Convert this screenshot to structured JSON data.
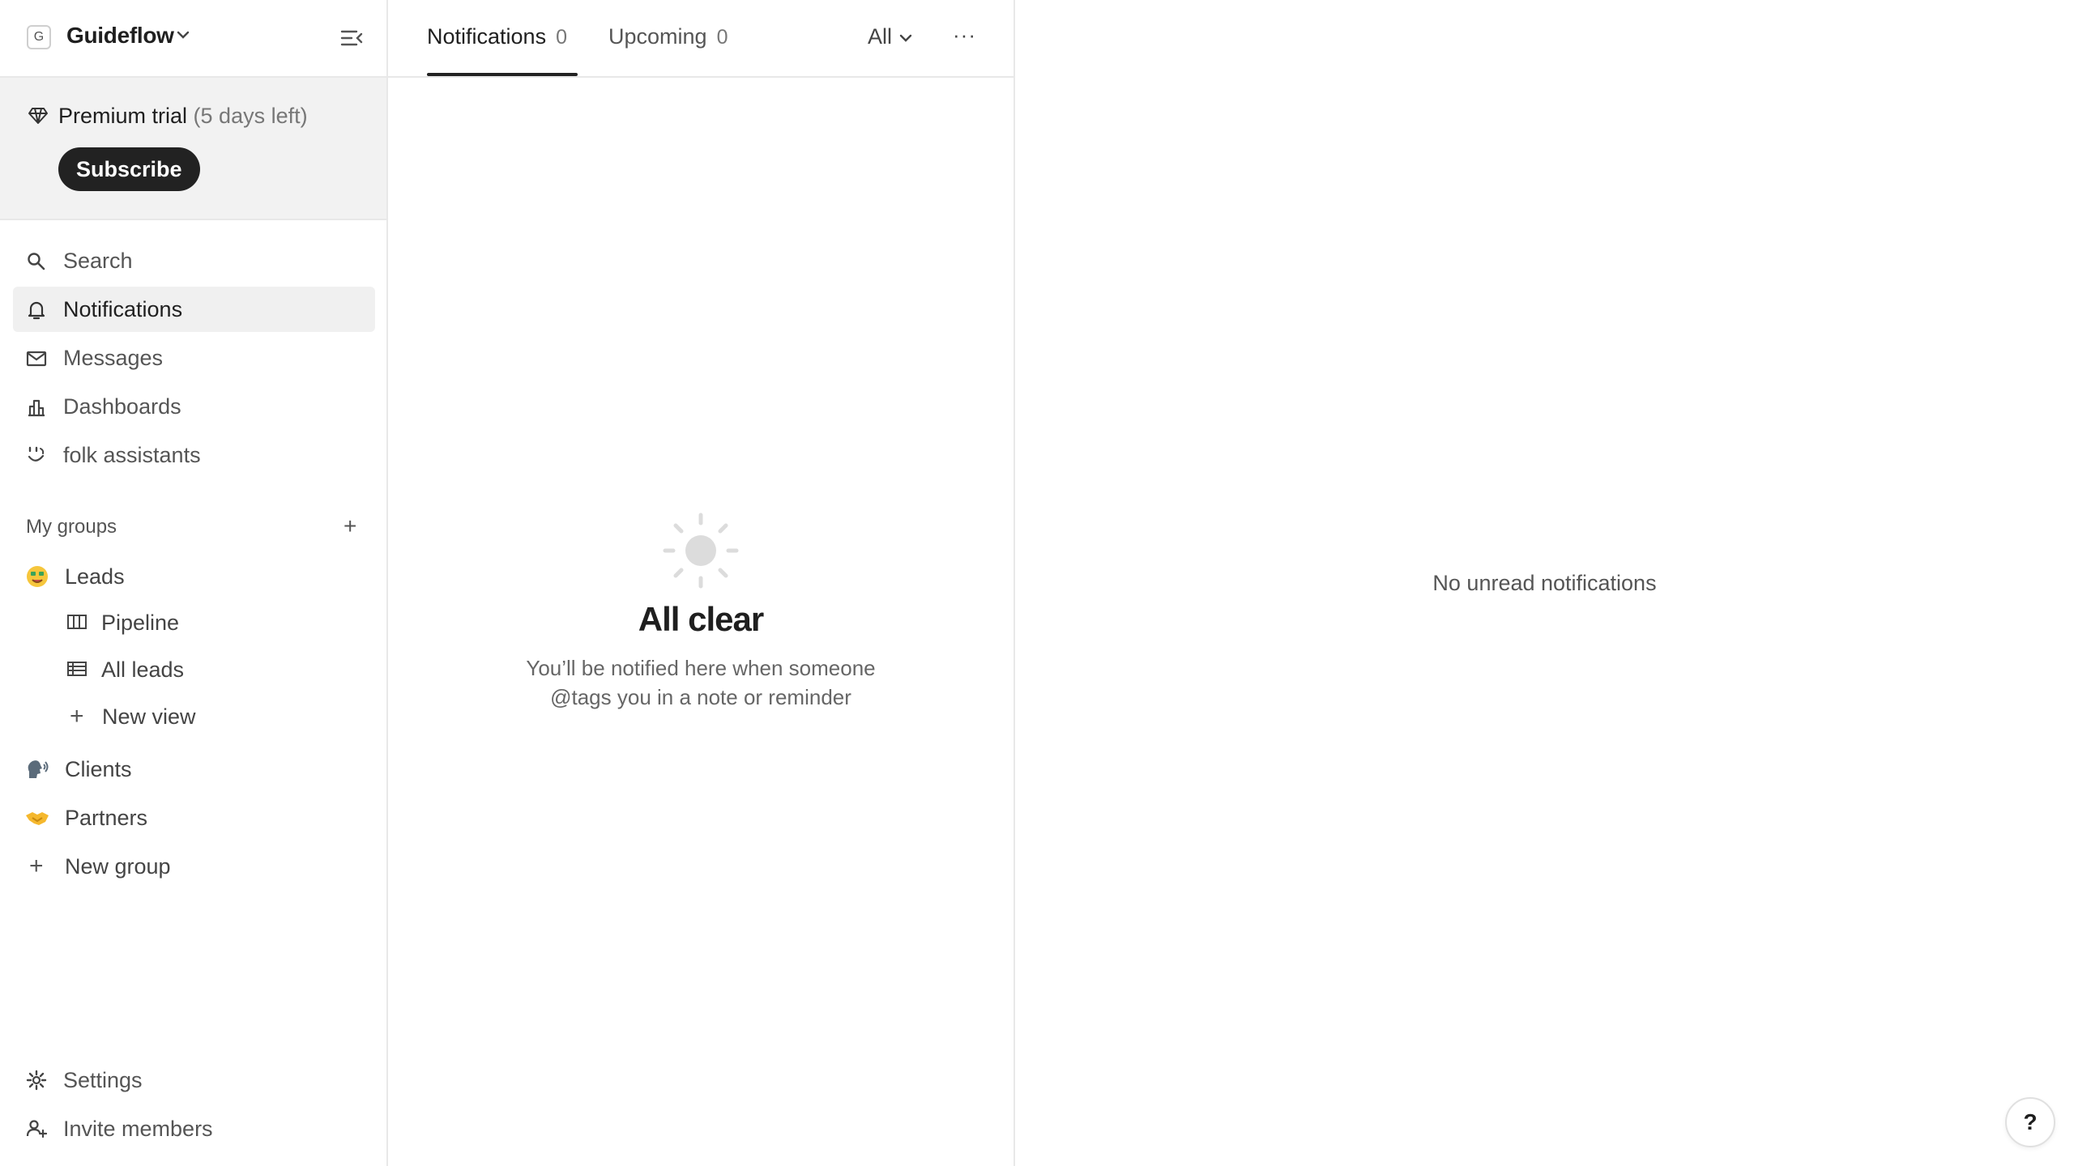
{
  "workspace": {
    "logo_letter": "G",
    "name": "Guideflow"
  },
  "trial": {
    "label": "Premium trial",
    "days_left": "(5 days left)",
    "subscribe_label": "Subscribe"
  },
  "nav": {
    "search": "Search",
    "notifications": "Notifications",
    "messages": "Messages",
    "dashboards": "Dashboards",
    "assistants": "folk assistants"
  },
  "groups": {
    "title": "My groups",
    "add": "+",
    "leads": {
      "label": "Leads",
      "emoji": "money-mouth-face-icon"
    },
    "pipeline": "Pipeline",
    "all_leads": "All leads",
    "new_view": "New view",
    "clients": {
      "label": "Clients",
      "emoji": "speaking-head-icon"
    },
    "partners": {
      "label": "Partners",
      "emoji": "handshake-icon"
    },
    "new_group": "New group"
  },
  "bottom": {
    "settings": "Settings",
    "invite": "Invite members"
  },
  "tabs": [
    {
      "label": "Notifications",
      "count": "0"
    },
    {
      "label": "Upcoming",
      "count": "0"
    }
  ],
  "filter": {
    "label": "All"
  },
  "more": "···",
  "empty": {
    "title": "All clear",
    "line1": "You’ll be notified here when someone",
    "line2": "@tags you in a note or reminder"
  },
  "right": {
    "message": "No unread notifications"
  },
  "help": {
    "label": "?"
  }
}
